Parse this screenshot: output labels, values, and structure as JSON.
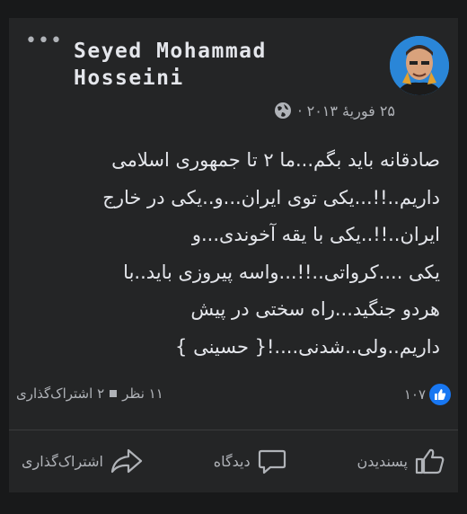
{
  "post": {
    "author": "Seyed Mohammad\nHosseini",
    "date": "۲۵ فوریهٔ ۲۰۱۳ ·",
    "more_label": "•••",
    "body_lines": [
      "صادقانه باید بگم...ما ۲ تا جمهوری اسلامی",
      "داریم..!!...یکی توی ایران...و..یکی در خارج",
      "ایران..!!..یکی با یقه آخوندی...و",
      "یکی ....کرواتی..!!...واسه پیروزی باید..با",
      "هردو جنگید...راه سختی در پیش",
      "داریم..ولی..شدنی....!{ حسینی }"
    ]
  },
  "stats": {
    "likes": "۱۰۷",
    "views": "۱۱ نظر",
    "shares": "۲ اشتراک‌گذاری"
  },
  "actions": {
    "like": "پسندیدن",
    "comment": "دیدگاه",
    "share": "اشتراک‌گذاری"
  },
  "colors": {
    "background": "#18191a",
    "card": "#242526",
    "text": "#e4e6eb",
    "secondary": "#b0b3b8",
    "like_blue": "#1877f2"
  }
}
